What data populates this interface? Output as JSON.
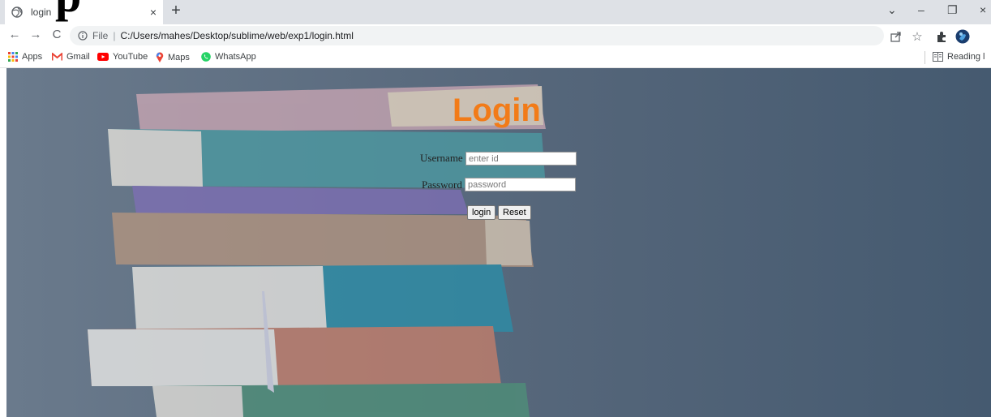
{
  "fragment_text": "p",
  "tab": {
    "title": "login",
    "close_symbol": "×",
    "new_tab_symbol": "+"
  },
  "window_controls": {
    "dropdown": "⌄",
    "minimize": "–",
    "restore": "❐",
    "close": "×"
  },
  "address_bar": {
    "file_label": "File",
    "separator": "|",
    "url": "C:/Users/mahes/Desktop/sublime/web/exp1/login.html"
  },
  "bookmarks": [
    {
      "label": "Apps",
      "icon": "apps-grid-icon"
    },
    {
      "label": "Gmail",
      "icon": "gmail-icon"
    },
    {
      "label": "YouTube",
      "icon": "youtube-icon"
    },
    {
      "label": "Maps",
      "icon": "maps-pin-icon"
    },
    {
      "label": "WhatsApp",
      "icon": "whatsapp-icon"
    }
  ],
  "reading_list": "Reading l",
  "page": {
    "title": "Login",
    "username_label": "Username",
    "username_placeholder": "enter id",
    "password_label": "Password",
    "password_placeholder": "password",
    "login_button": "login",
    "reset_button": "Reset"
  },
  "colors": {
    "title_orange": "#f27b18",
    "background_slate": "#55667a"
  }
}
